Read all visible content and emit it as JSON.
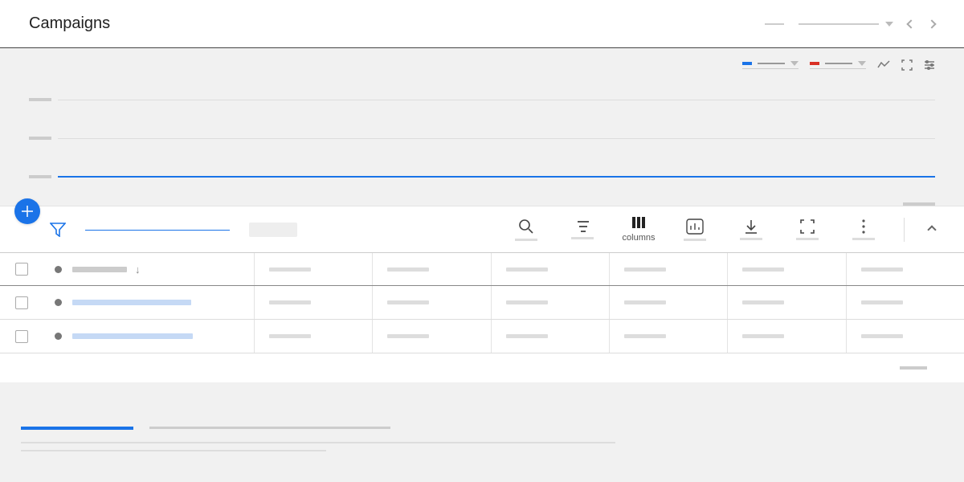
{
  "header": {
    "title": "Campaigns"
  },
  "metrics": {
    "a_color": "#1a73e8",
    "b_color": "#d93025"
  },
  "toolbar": {
    "columns_label": "columns"
  },
  "table": {
    "rows": [
      {
        "name_width": 68,
        "name_color": "#ccc",
        "sorted": true
      },
      {
        "name_width": 148,
        "name_color": "#c5d9f5"
      },
      {
        "name_width": 150,
        "name_color": "#c5d9f5"
      }
    ]
  }
}
